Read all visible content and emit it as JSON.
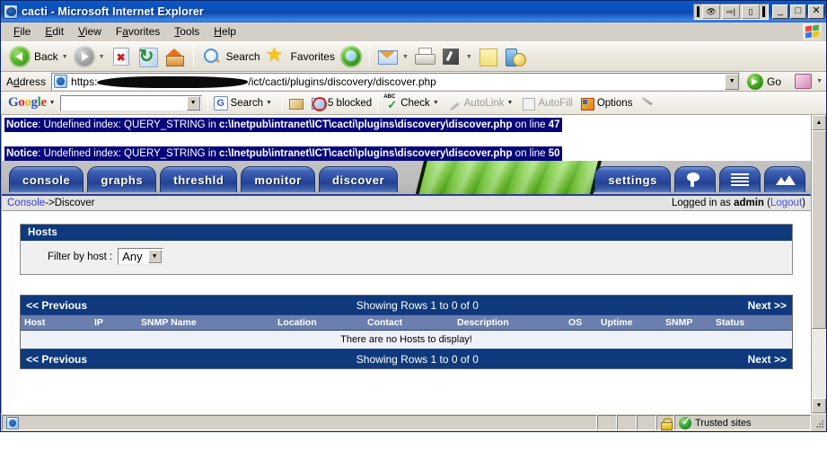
{
  "window": {
    "title": "cacti - Microsoft Internet Explorer",
    "titlebar_icons": [
      "eye-icon",
      "export-icon",
      "window-icon"
    ],
    "system_buttons": {
      "minimize": "_",
      "maximize": "□",
      "close": "✕"
    }
  },
  "menu": {
    "items": [
      {
        "label": "File",
        "accel": "F"
      },
      {
        "label": "Edit",
        "accel": "E"
      },
      {
        "label": "View",
        "accel": "V"
      },
      {
        "label": "Favorites",
        "accel": "a"
      },
      {
        "label": "Tools",
        "accel": "T"
      },
      {
        "label": "Help",
        "accel": "H"
      }
    ]
  },
  "toolbar": {
    "back_label": "Back",
    "search_label": "Search",
    "favorites_label": "Favorites",
    "icons": [
      "back-icon",
      "forward-icon",
      "stop-icon",
      "refresh-icon",
      "home-icon",
      "search-icon",
      "favorites-star-icon",
      "media-icon",
      "mail-icon",
      "print-icon",
      "edit-icon",
      "notes-icon",
      "messenger-icon"
    ]
  },
  "address": {
    "label": "Address",
    "url_prefix": "https:",
    "url_redacted": true,
    "url_suffix": "/ict/cacti/plugins/discovery/discover.php",
    "go_label": "Go"
  },
  "google_toolbar": {
    "brand": "Google",
    "search_value": "",
    "search_label": "Search",
    "blocked_label": "5 blocked",
    "check_label": "Check",
    "autolink_label": "AutoLink",
    "autofill_label": "AutoFill",
    "options_label": "Options"
  },
  "php_notices": [
    {
      "prefix": "Notice",
      "text": ": Undefined index: QUERY_STRING in ",
      "path": "c:\\Inetpub\\intranet\\ICT\\cacti\\plugins\\discovery\\discover.php",
      "line_label": " on line ",
      "line": "47"
    },
    {
      "prefix": "Notice",
      "text": ": Undefined index: QUERY_STRING in ",
      "path": "c:\\Inetpub\\intranet\\ICT\\cacti\\plugins\\discovery\\discover.php",
      "line_label": " on line ",
      "line": "50"
    }
  ],
  "cacti_nav": {
    "tabs": [
      "console",
      "graphs",
      "threshld",
      "monitor",
      "discover"
    ],
    "right_tabs": [
      {
        "label": "settings",
        "icon": null
      },
      {
        "label": "",
        "icon": "tree-icon"
      },
      {
        "label": "",
        "icon": "list-lines-icon"
      },
      {
        "label": "",
        "icon": "mountains-icon"
      }
    ]
  },
  "breadcrumb": {
    "root": "Console",
    "separator": " -> ",
    "current": "Discover",
    "logged_in_prefix": "Logged in as ",
    "user": "admin",
    "logout_open": " (",
    "logout": "Logout",
    "logout_close": ")"
  },
  "hosts_panel": {
    "title": "Hosts",
    "filter_label": "Filter by host :",
    "filter_value": "Any"
  },
  "results": {
    "previous_label": "<< Previous",
    "next_label": "Next >>",
    "showing": "Showing Rows 1 to 0 of 0",
    "columns": [
      "Host",
      "IP",
      "SNMP Name",
      "Location",
      "Contact",
      "Description",
      "OS",
      "Uptime",
      "SNMP",
      "Status"
    ],
    "empty_message": "There are no Hosts to display!",
    "rows": []
  },
  "statusbar": {
    "message": "",
    "zone": "Trusted sites",
    "lock_icon": "lock-icon",
    "trusted_icon": "trusted-sites-icon"
  },
  "colors": {
    "titlebar_blue": "#0a47ab",
    "cacti_header_blue": "#2d4ea6",
    "panel_head_blue": "#0e3a7d",
    "column_head_blue": "#6a7fae",
    "notice_select_blue": "#06067a",
    "swoosh_green": "#63c41f"
  }
}
